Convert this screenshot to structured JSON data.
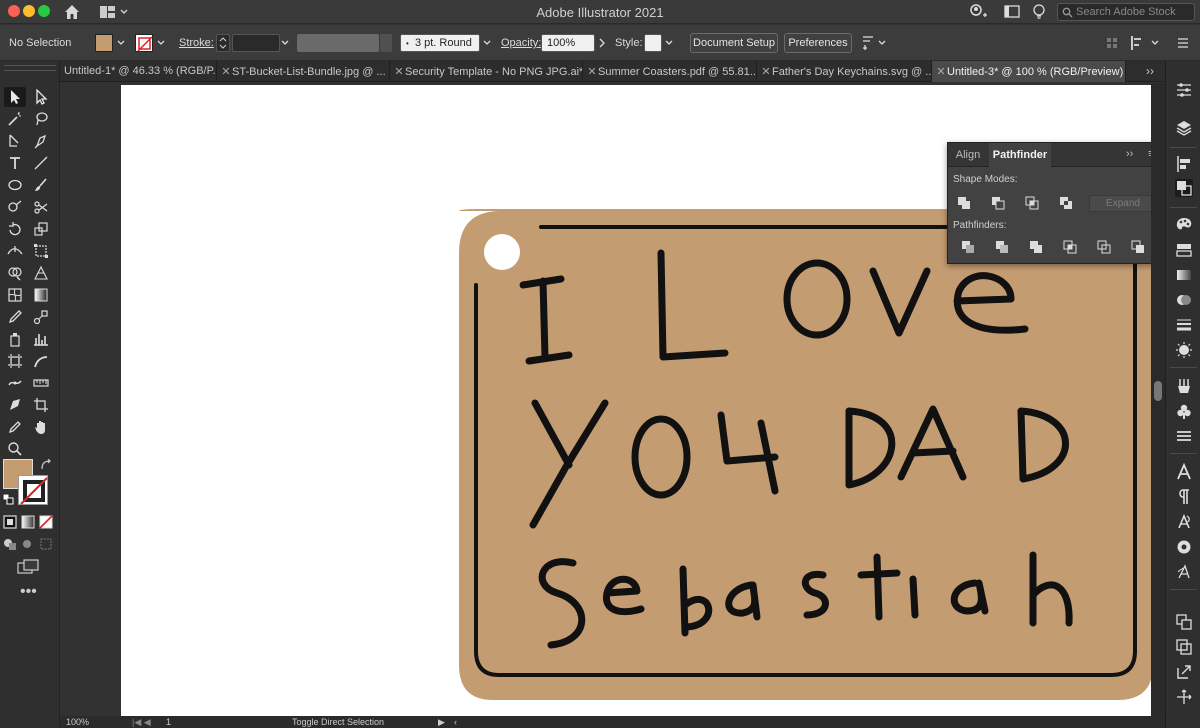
{
  "app": {
    "title": "Adobe Illustrator 2021",
    "search_placeholder": "Search Adobe Stock"
  },
  "control_bar": {
    "selection": "No Selection",
    "stroke_label": "Stroke:",
    "brush_label": "3 pt. Round",
    "opacity_label": "Opacity:",
    "opacity_value": "100%",
    "style_label": "Style:",
    "document_setup": "Document Setup",
    "preferences": "Preferences",
    "fill_color": "#c49c72",
    "stroke_color": "#ffffff"
  },
  "tabs": [
    {
      "label": "Untitled-1* @ 46.33 % (RGB/P...",
      "active": false
    },
    {
      "label": "ST-Bucket-List-Bundle.jpg @ ...",
      "active": false
    },
    {
      "label": "Security Template - No PNG JPG.ai*",
      "active": false
    },
    {
      "label": "Summer Coasters.pdf @ 55.81...",
      "active": false
    },
    {
      "label": "Father's Day Keychains.svg @ ...",
      "active": false
    },
    {
      "label": "Untitled-3* @ 100 % (RGB/Preview)",
      "active": true
    }
  ],
  "tabs_overflow": "››",
  "pathfinder_panel": {
    "tab_align": "Align",
    "tab_pathfinder": "Pathfinder",
    "collapse": "››",
    "menu": "≡",
    "shape_modes_label": "Shape Modes:",
    "pathfinders_label": "Pathfinders:",
    "expand_label": "Expand"
  },
  "artwork": {
    "keychain_color": "#c49c72",
    "line1": "I Love",
    "line2": "YOU DAD",
    "line3": "Sebastian"
  },
  "status_bar": {
    "zoom": "100%",
    "page": "1",
    "tool_hint": "Toggle Direct Selection"
  }
}
